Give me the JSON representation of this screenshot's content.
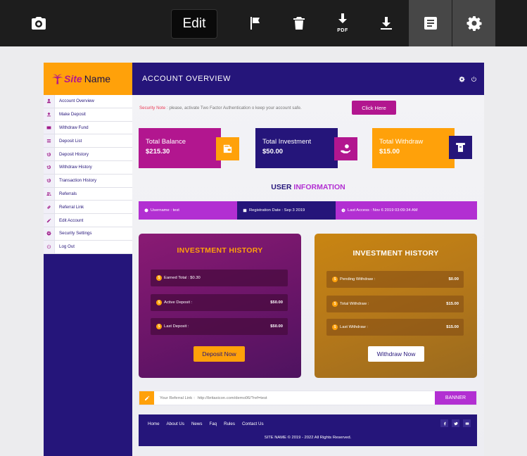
{
  "toolbar": {
    "edit_label": "Edit",
    "pdf_label": "PDF",
    "icons": [
      "camera-icon",
      "flag-icon",
      "trash-icon",
      "pdf-download-icon",
      "download-icon",
      "document-icon",
      "gear-icon"
    ]
  },
  "logo": {
    "site": "Site",
    "name": "Name"
  },
  "sidebar": {
    "items": [
      {
        "label": "Account Overview",
        "icon": "user-icon"
      },
      {
        "label": "Make Deposit",
        "icon": "upload-icon"
      },
      {
        "label": "Withdraw Fund",
        "icon": "card-icon"
      },
      {
        "label": "Deposit List",
        "icon": "list-icon"
      },
      {
        "label": "Deposit History",
        "icon": "history-icon"
      },
      {
        "label": "Withdraw History",
        "icon": "history-icon"
      },
      {
        "label": "Transaction History",
        "icon": "history-icon"
      },
      {
        "label": "Referrals",
        "icon": "users-icon"
      },
      {
        "label": "Referral Link",
        "icon": "link-icon"
      },
      {
        "label": "Edit Account",
        "icon": "edit-icon"
      },
      {
        "label": "Security Settings",
        "icon": "gear-icon"
      },
      {
        "label": "Log Out",
        "icon": "power-icon"
      }
    ]
  },
  "header": {
    "title": "ACCOUNT OVERVIEW"
  },
  "security": {
    "label": "Security Note",
    "text": ": please, activate Two Factor Authentication o keep your account safe.",
    "button": "Click Here"
  },
  "cards": {
    "balance": {
      "label": "Total Balance",
      "value": "$215.30"
    },
    "investment": {
      "label": "Total Investment",
      "value": "$50.00"
    },
    "withdraw": {
      "label": "Total Withdraw",
      "value": "$15.00"
    }
  },
  "user_info": {
    "title_main": "USER",
    "title_accent": "INFORMATION",
    "username": "Username : test",
    "registration": "Registration Date : Sep 3 2019",
    "last_access": "Last Access : Nov 6 2019 03:09:34 AM"
  },
  "panel_left": {
    "title": "INVESTMENT HISTORY",
    "rows": [
      {
        "label": "Earned Total : $0.30",
        "value": ""
      },
      {
        "label": "Active Deposit :",
        "value": "$50.00"
      },
      {
        "label": "Last Deposit :",
        "value": "$50.00"
      }
    ],
    "button": "Deposit Now"
  },
  "panel_right": {
    "title": "INVESTMENT HISTORY",
    "rows": [
      {
        "label": "Pending Withdraw :",
        "value": "$0.00"
      },
      {
        "label": "Total Withdraw :",
        "value": "$15.00"
      },
      {
        "label": "Last Withdraw :",
        "value": "$15.00"
      }
    ],
    "button": "Withdraw Now"
  },
  "referral": {
    "label": "Your Referral Link",
    "link": "http://britaxicon.com/demo06/?ref=test",
    "button": "BANNER"
  },
  "footer": {
    "links": [
      "Home",
      "About Us",
      "News",
      "Faq",
      "Rules",
      "Contact Us"
    ],
    "copyright": "SITE NAME © 2019 - 2022 All Rights Reserved.",
    "social": [
      "facebook-icon",
      "twitter-icon",
      "youtube-icon"
    ]
  },
  "colors": {
    "navy": "#25157a",
    "orange": "#ffa10a",
    "magenta": "#b2168f",
    "purple": "#b22fd2"
  }
}
